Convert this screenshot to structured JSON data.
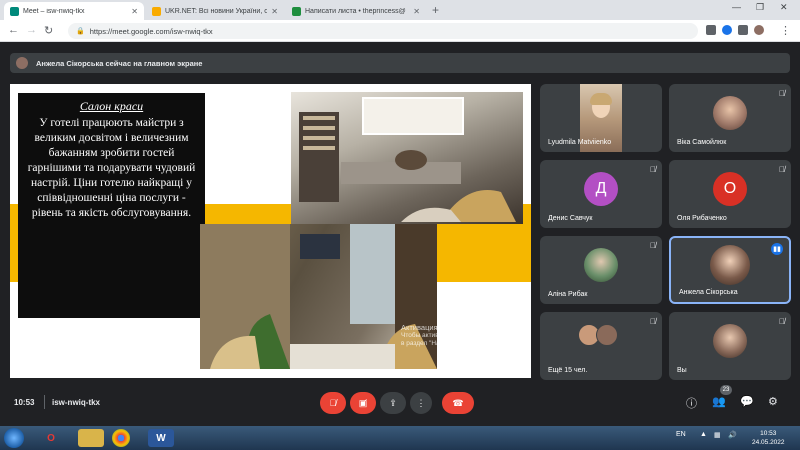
{
  "browser": {
    "tabs": [
      {
        "title": "Meet – isw-nwiq-tkx",
        "favicon_color": "#00897b",
        "active": true
      },
      {
        "title": "UKR.NET: Всі новини України, о",
        "favicon_color": "#f9ab00",
        "active": false
      },
      {
        "title": "Написати листа • theprincess@",
        "favicon_color": "#1e8e3e",
        "active": false
      }
    ],
    "url": "https://meet.google.com/isw-nwiq-tkx"
  },
  "banner": {
    "text": "Анжела Сікорська сейчас на главном экране"
  },
  "slide": {
    "title": "Салон краси",
    "body": "У готелі працюють майстри з великим досвітом і величезним бажанням зробити гостей гарнішими та подарувати чудовий настрій. Ціни готелю найкращі у співвідношенні ціна послуги - рівень та якість обслуговування.",
    "watermark_line1": "Активация Windows",
    "watermark_line2": "Чтобы активировать Windows, перейдите в раздел \"Настройки\".",
    "accent_color": "#f5b700"
  },
  "participants": [
    {
      "name": "Lyudmila Matviienko",
      "kind": "camera",
      "muted": false
    },
    {
      "name": "Віка Самойлюк",
      "kind": "photo",
      "muted": true,
      "avatar_color": "#a07a6a"
    },
    {
      "name": "Денис Савчук",
      "kind": "letter",
      "letter": "Д",
      "muted": true,
      "avatar_color": "#b34fc4"
    },
    {
      "name": "Оля Рибаченко",
      "kind": "letter",
      "letter": "О",
      "muted": true,
      "avatar_color": "#d93025"
    },
    {
      "name": "Аліна Рибак",
      "kind": "photo",
      "muted": true,
      "avatar_color": "#6a8f6a"
    },
    {
      "name": "Анжела Сікорська",
      "kind": "photo",
      "muted": false,
      "speaking": true,
      "avatar_color": "#7a5a4a"
    },
    {
      "name": "Ещё 15 чел.",
      "kind": "group",
      "muted": true
    },
    {
      "name": "Вы",
      "kind": "photo",
      "muted": true,
      "avatar_color": "#8a6a5a"
    }
  ],
  "meeting": {
    "time": "10:53",
    "code": "isw-nwiq-tkx",
    "participant_count": "23"
  },
  "taskbar": {
    "language": "EN",
    "time": "10:53",
    "date": "24.05.2022"
  }
}
